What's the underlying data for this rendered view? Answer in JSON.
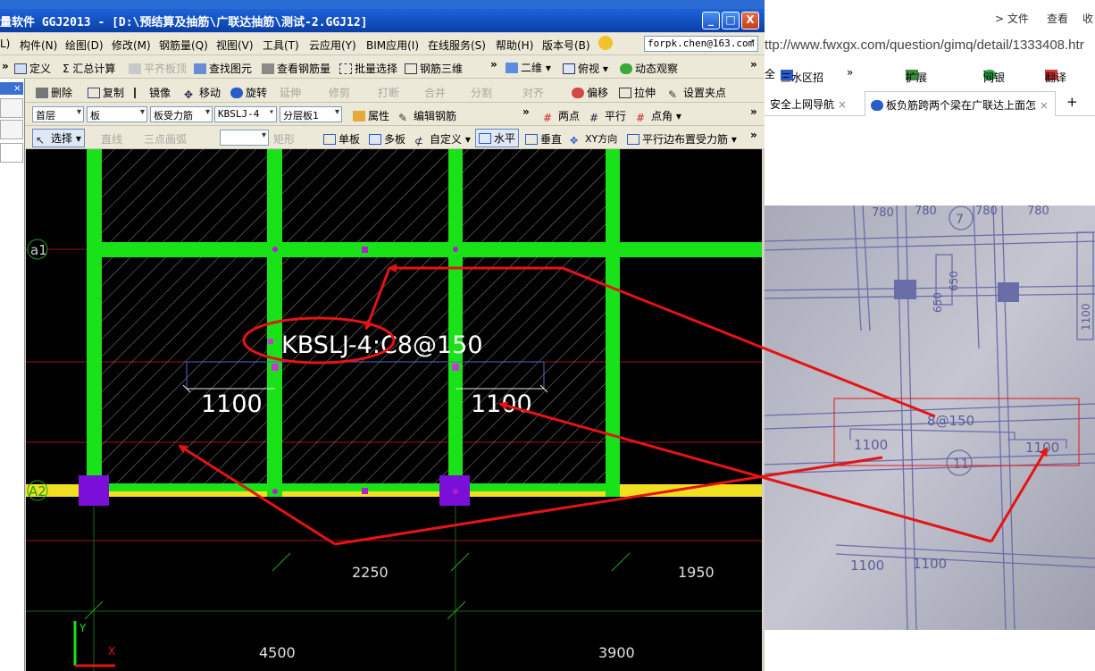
{
  "window": {
    "title": "量软件 GGJ2013 - [D:\\预结算及抽筋\\广联达抽筋\\测试-2.GGJ12]",
    "btn_min": "_",
    "btn_max": "□",
    "btn_close": "X"
  },
  "menubar": {
    "items": [
      "L)",
      "构件(N)",
      "绘图(D)",
      "修改(M)",
      "钢筋量(Q)",
      "视图(V)",
      "工具(T)",
      "云应用(Y)",
      "BIM应用(I)",
      "在线服务(S)",
      "帮助(H)",
      "版本号(B)"
    ],
    "account": "forpk.chen@163.com"
  },
  "toolbar1": {
    "items": [
      "定义",
      "Σ 汇总计算",
      "平齐板顶",
      "查找图元",
      "查看钢筋量",
      "批量选择",
      "钢筋三维",
      "二维",
      "俯视",
      "动态观察"
    ],
    "more": "»"
  },
  "toolbar2": {
    "items": [
      "删除",
      "复制",
      "镜像",
      "移动",
      "旋转",
      "延伸",
      "修剪",
      "打断",
      "合并",
      "分割",
      "对齐",
      "偏移",
      "拉伸",
      "设置夹点"
    ]
  },
  "toolbar3": {
    "floor": "首层",
    "type": "板",
    "subtype": "板受力筋",
    "code": "KBSLJ-4",
    "layer": "分层板1",
    "items": [
      "属性",
      "编辑钢筋",
      "两点",
      "平行",
      "点角"
    ]
  },
  "toolbar4": {
    "items": [
      "选择",
      "直线",
      "三点画弧",
      "矩形",
      "单板",
      "多板",
      "自定义",
      "水平",
      "垂直",
      "XY方向",
      "平行边布置受力筋"
    ],
    "empty_combo": ""
  },
  "leftpanel": {
    "close": "×"
  },
  "drawing": {
    "axis_a1": "a1",
    "axis_a2": "A2",
    "rebar_label": "KBSLJ-4:C8@150",
    "len_left": "1100",
    "len_right": "1100",
    "dim_2250": "2250",
    "dim_1950": "1950",
    "dim_4500": "4500",
    "dim_3900": "3900",
    "ucs_y": "Y",
    "ucs_x": "X",
    "colors": {
      "beam": "#19e219",
      "wall": "#f0e021",
      "column": "#7a10d8",
      "arrow": "#e51414"
    }
  },
  "browser": {
    "menu": [
      "> 文件",
      "查看",
      "收"
    ],
    "address": "ttp://www.fwxgx.com/question/gimq/detail/1333408.htr",
    "favorites": [
      "全",
      "三水区招",
      "»",
      "扩展",
      "网银",
      "翻译"
    ],
    "tabs": [
      "安全上网导航",
      "板负筋跨两个梁在广联达上面怎",
      "+"
    ]
  },
  "photo": {
    "labels": [
      "780",
      "780",
      "7",
      "780",
      "780",
      "650",
      "650",
      "1100",
      "8@150",
      "1100",
      "1100",
      "11",
      "1100",
      "1100"
    ]
  }
}
